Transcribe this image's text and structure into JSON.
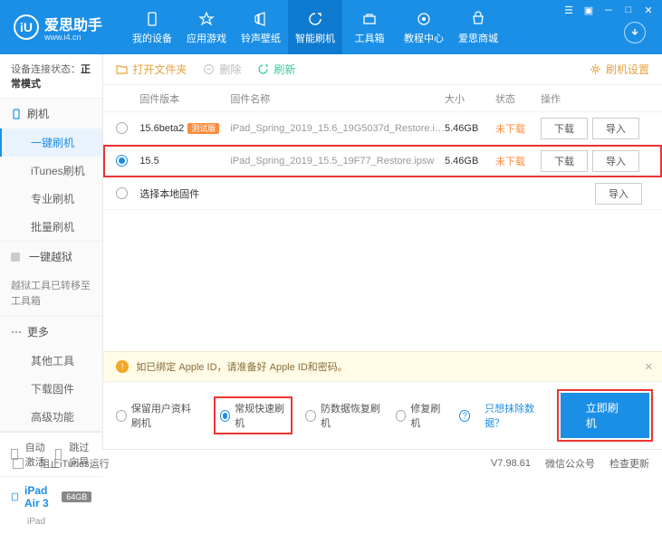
{
  "header": {
    "brand": "爱思助手",
    "url": "www.i4.cn",
    "nav": [
      "我的设备",
      "应用游戏",
      "铃声壁纸",
      "智能刷机",
      "工具箱",
      "教程中心",
      "爱思商城"
    ],
    "active_nav": 3
  },
  "sidebar": {
    "status_label": "设备连接状态：",
    "status_value": "正常模式",
    "group_flash": "刷机",
    "items_flash": [
      "一键刷机",
      "iTunes刷机",
      "专业刷机",
      "批量刷机"
    ],
    "active_flash": 0,
    "group_jail": "一键越狱",
    "jail_note": "越狱工具已转移至工具箱",
    "group_more": "更多",
    "items_more": [
      "其他工具",
      "下载固件",
      "高级功能"
    ],
    "auto_activate": "自动激活",
    "skip_guide": "跳过向导",
    "device_name": "iPad Air 3",
    "device_storage": "64GB",
    "device_type": "iPad"
  },
  "toolbar": {
    "open_folder": "打开文件夹",
    "delete": "删除",
    "refresh": "刷新",
    "settings": "刷机设置"
  },
  "table": {
    "h_ver": "固件版本",
    "h_name": "固件名称",
    "h_size": "大小",
    "h_stat": "状态",
    "h_ops": "操作",
    "rows": [
      {
        "ver": "15.6beta2",
        "beta": "测试版",
        "name": "iPad_Spring_2019_15.6_19G5037d_Restore.i…",
        "size": "5.46GB",
        "stat": "未下载",
        "sel": false
      },
      {
        "ver": "15.5",
        "beta": "",
        "name": "iPad_Spring_2019_15.5_19F77_Restore.ipsw",
        "size": "5.46GB",
        "stat": "未下载",
        "sel": true
      }
    ],
    "local_fw": "选择本地固件",
    "btn_dl": "下载",
    "btn_imp": "导入"
  },
  "notice": "如已绑定 Apple ID，请准备好 Apple ID和密码。",
  "options": {
    "o1": "保留用户资料刷机",
    "o2": "常规快速刷机",
    "o3": "防数据恢复刷机",
    "o4": "修复刷机",
    "link": "只想抹除数据？",
    "go": "立即刷机"
  },
  "footer": {
    "block_itunes": "阻止iTunes运行",
    "ver": "V7.98.61",
    "wechat": "微信公众号",
    "update": "检查更新"
  }
}
